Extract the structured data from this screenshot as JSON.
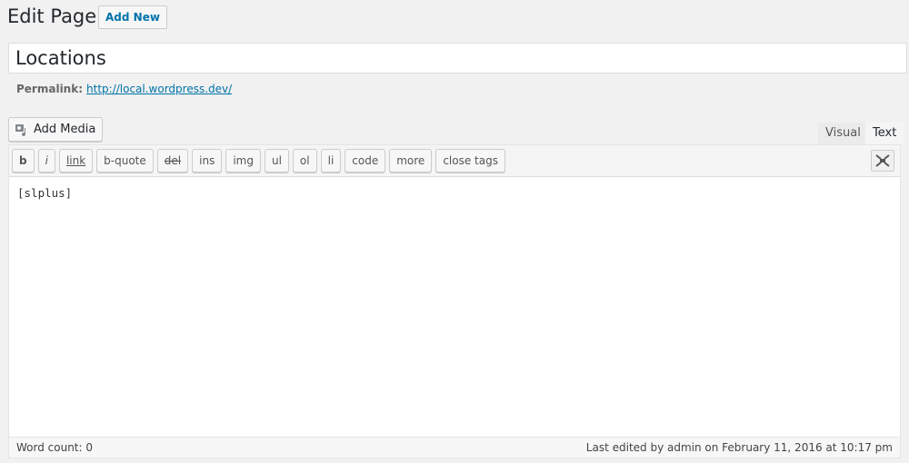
{
  "header": {
    "title": "Edit Page",
    "add_new": "Add New"
  },
  "post": {
    "title": "Locations",
    "permalink_label": "Permalink:",
    "permalink_url": "http://local.wordpress.dev/"
  },
  "media": {
    "label": "Add Media",
    "icon": "media-icon"
  },
  "tabs": {
    "visual": "Visual",
    "text": "Text",
    "active": "Text"
  },
  "toolbar": [
    {
      "label": "b",
      "style": "b"
    },
    {
      "label": "i",
      "style": "i"
    },
    {
      "label": "link",
      "style": "u"
    },
    {
      "label": "b-quote",
      "style": ""
    },
    {
      "label": "del",
      "style": "s"
    },
    {
      "label": "ins",
      "style": ""
    },
    {
      "label": "img",
      "style": ""
    },
    {
      "label": "ul",
      "style": ""
    },
    {
      "label": "ol",
      "style": ""
    },
    {
      "label": "li",
      "style": ""
    },
    {
      "label": "code",
      "style": ""
    },
    {
      "label": "more",
      "style": ""
    },
    {
      "label": "close tags",
      "style": ""
    }
  ],
  "content": "[slplus]",
  "footer": {
    "word_count": "Word count: 0",
    "last_edited": "Last edited by admin on February 11, 2016 at 10:17 pm"
  }
}
